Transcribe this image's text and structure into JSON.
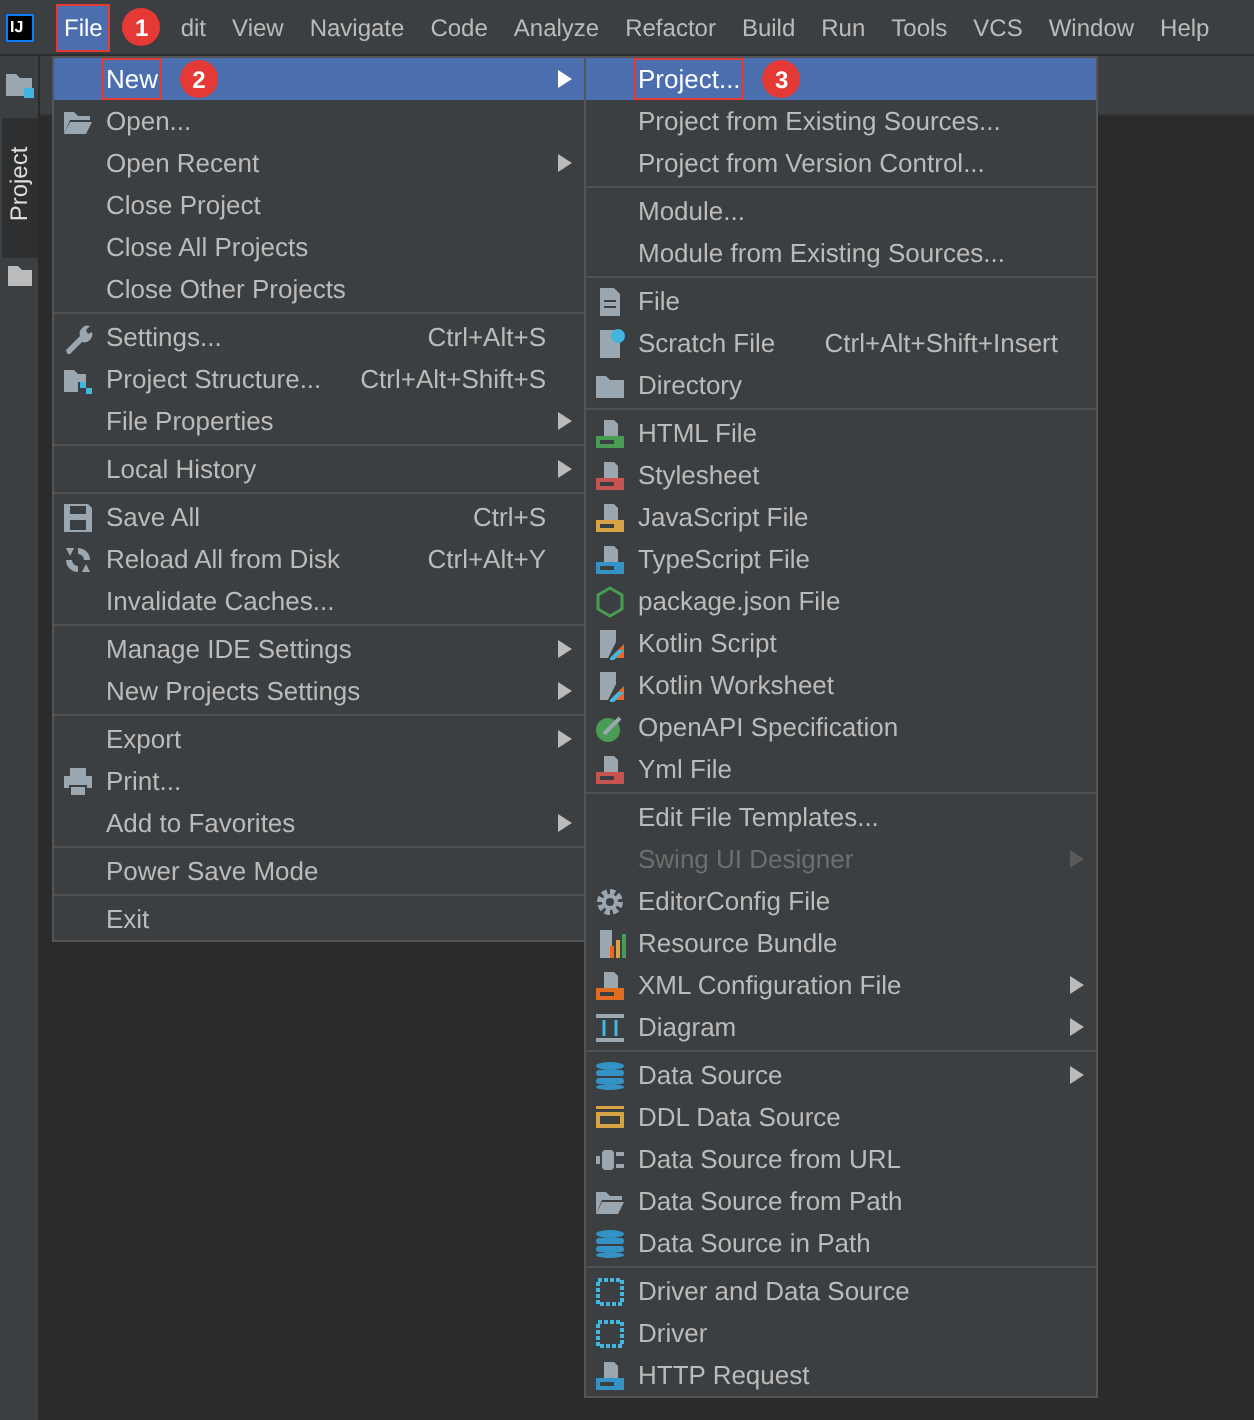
{
  "logo": "IJ",
  "menubar": [
    {
      "label": "File",
      "selected": true,
      "highlighted": true,
      "marker": "1"
    },
    {
      "label": "dit",
      "selected": false
    },
    {
      "label": "View",
      "selected": false
    },
    {
      "label": "Navigate",
      "selected": false
    },
    {
      "label": "Code",
      "selected": false
    },
    {
      "label": "Analyze",
      "selected": false
    },
    {
      "label": "Refactor",
      "selected": false
    },
    {
      "label": "Build",
      "selected": false
    },
    {
      "label": "Run",
      "selected": false
    },
    {
      "label": "Tools",
      "selected": false
    },
    {
      "label": "VCS",
      "selected": false
    },
    {
      "label": "Window",
      "selected": false
    },
    {
      "label": "Help",
      "selected": false
    }
  ],
  "tool_window_tab": {
    "label": "Project",
    "selected": true
  },
  "file_menu": {
    "items": [
      {
        "kind": "item",
        "label": "New",
        "submenu": true,
        "selected": true,
        "highlighted": true,
        "marker": "2"
      },
      {
        "kind": "item",
        "label": "Open...",
        "submenu": false,
        "selected": false
      },
      {
        "kind": "item",
        "label": "Open Recent",
        "submenu": true,
        "selected": false
      },
      {
        "kind": "item",
        "label": "Close Project",
        "submenu": false,
        "selected": false
      },
      {
        "kind": "item",
        "label": "Close All Projects",
        "submenu": false,
        "selected": false
      },
      {
        "kind": "item",
        "label": "Close Other Projects",
        "submenu": false,
        "selected": false
      },
      {
        "kind": "separator"
      },
      {
        "kind": "item",
        "label": "Settings...",
        "shortcut": "Ctrl+Alt+S",
        "submenu": false,
        "selected": false
      },
      {
        "kind": "item",
        "label": "Project Structure...",
        "shortcut": "Ctrl+Alt+Shift+S",
        "submenu": false,
        "selected": false
      },
      {
        "kind": "item",
        "label": "File Properties",
        "submenu": true,
        "selected": false
      },
      {
        "kind": "separator"
      },
      {
        "kind": "item",
        "label": "Local History",
        "submenu": true,
        "selected": false
      },
      {
        "kind": "separator"
      },
      {
        "kind": "item",
        "label": "Save All",
        "shortcut": "Ctrl+S",
        "submenu": false,
        "selected": false
      },
      {
        "kind": "item",
        "label": "Reload All from Disk",
        "shortcut": "Ctrl+Alt+Y",
        "submenu": false,
        "selected": false
      },
      {
        "kind": "item",
        "label": "Invalidate Caches...",
        "submenu": false,
        "selected": false
      },
      {
        "kind": "separator"
      },
      {
        "kind": "item",
        "label": "Manage IDE Settings",
        "submenu": true,
        "selected": false
      },
      {
        "kind": "item",
        "label": "New Projects Settings",
        "submenu": true,
        "selected": false
      },
      {
        "kind": "separator"
      },
      {
        "kind": "item",
        "label": "Export",
        "submenu": true,
        "selected": false
      },
      {
        "kind": "item",
        "label": "Print...",
        "submenu": false,
        "selected": false
      },
      {
        "kind": "item",
        "label": "Add to Favorites",
        "submenu": true,
        "selected": false
      },
      {
        "kind": "separator"
      },
      {
        "kind": "item",
        "label": "Power Save Mode",
        "submenu": false,
        "selected": false
      },
      {
        "kind": "separator"
      },
      {
        "kind": "item",
        "label": "Exit",
        "submenu": false,
        "selected": false
      }
    ]
  },
  "new_submenu": {
    "items": [
      {
        "kind": "item",
        "label": "Project...",
        "submenu": false,
        "selected": true,
        "disabled": false,
        "highlighted": true,
        "marker": "3"
      },
      {
        "kind": "item",
        "label": "Project from Existing Sources...",
        "submenu": false,
        "selected": false,
        "disabled": false
      },
      {
        "kind": "item",
        "label": "Project from Version Control...",
        "submenu": false,
        "selected": false,
        "disabled": false
      },
      {
        "kind": "separator"
      },
      {
        "kind": "item",
        "label": "Module...",
        "submenu": false,
        "selected": false,
        "disabled": false
      },
      {
        "kind": "item",
        "label": "Module from Existing Sources...",
        "submenu": false,
        "selected": false,
        "disabled": false
      },
      {
        "kind": "separator"
      },
      {
        "kind": "item",
        "label": "File",
        "submenu": false,
        "selected": false,
        "disabled": false
      },
      {
        "kind": "item",
        "label": "Scratch File",
        "shortcut": "Ctrl+Alt+Shift+Insert",
        "submenu": false,
        "selected": false,
        "disabled": false
      },
      {
        "kind": "item",
        "label": "Directory",
        "submenu": false,
        "selected": false,
        "disabled": false
      },
      {
        "kind": "separator"
      },
      {
        "kind": "item",
        "label": "HTML File",
        "submenu": false,
        "selected": false,
        "disabled": false
      },
      {
        "kind": "item",
        "label": "Stylesheet",
        "submenu": false,
        "selected": false,
        "disabled": false
      },
      {
        "kind": "item",
        "label": "JavaScript File",
        "submenu": false,
        "selected": false,
        "disabled": false
      },
      {
        "kind": "item",
        "label": "TypeScript File",
        "submenu": false,
        "selected": false,
        "disabled": false
      },
      {
        "kind": "item",
        "label": "package.json File",
        "submenu": false,
        "selected": false,
        "disabled": false
      },
      {
        "kind": "item",
        "label": "Kotlin Script",
        "submenu": false,
        "selected": false,
        "disabled": false
      },
      {
        "kind": "item",
        "label": "Kotlin Worksheet",
        "submenu": false,
        "selected": false,
        "disabled": false
      },
      {
        "kind": "item",
        "label": "OpenAPI Specification",
        "submenu": false,
        "selected": false,
        "disabled": false
      },
      {
        "kind": "item",
        "label": "Yml File",
        "submenu": false,
        "selected": false,
        "disabled": false
      },
      {
        "kind": "separator"
      },
      {
        "kind": "item",
        "label": "Edit File Templates...",
        "submenu": false,
        "selected": false,
        "disabled": false
      },
      {
        "kind": "item",
        "label": "Swing UI Designer",
        "submenu": true,
        "selected": false,
        "disabled": true
      },
      {
        "kind": "item",
        "label": "EditorConfig File",
        "submenu": false,
        "selected": false,
        "disabled": false
      },
      {
        "kind": "item",
        "label": "Resource Bundle",
        "submenu": false,
        "selected": false,
        "disabled": false
      },
      {
        "kind": "item",
        "label": "XML Configuration File",
        "submenu": true,
        "selected": false,
        "disabled": false
      },
      {
        "kind": "item",
        "label": "Diagram",
        "submenu": true,
        "selected": false,
        "disabled": false
      },
      {
        "kind": "separator"
      },
      {
        "kind": "item",
        "label": "Data Source",
        "submenu": true,
        "selected": false,
        "disabled": false
      },
      {
        "kind": "item",
        "label": "DDL Data Source",
        "submenu": false,
        "selected": false,
        "disabled": false
      },
      {
        "kind": "item",
        "label": "Data Source from URL",
        "submenu": false,
        "selected": false,
        "disabled": false
      },
      {
        "kind": "item",
        "label": "Data Source from Path",
        "submenu": false,
        "selected": false,
        "disabled": false
      },
      {
        "kind": "item",
        "label": "Data Source in Path",
        "submenu": false,
        "selected": false,
        "disabled": false
      },
      {
        "kind": "separator"
      },
      {
        "kind": "item",
        "label": "Driver and Data Source",
        "submenu": false,
        "selected": false,
        "disabled": false
      },
      {
        "kind": "item",
        "label": "Driver",
        "submenu": false,
        "selected": false,
        "disabled": false
      },
      {
        "kind": "item",
        "label": "HTTP Request",
        "submenu": false,
        "selected": false,
        "disabled": false
      }
    ]
  }
}
